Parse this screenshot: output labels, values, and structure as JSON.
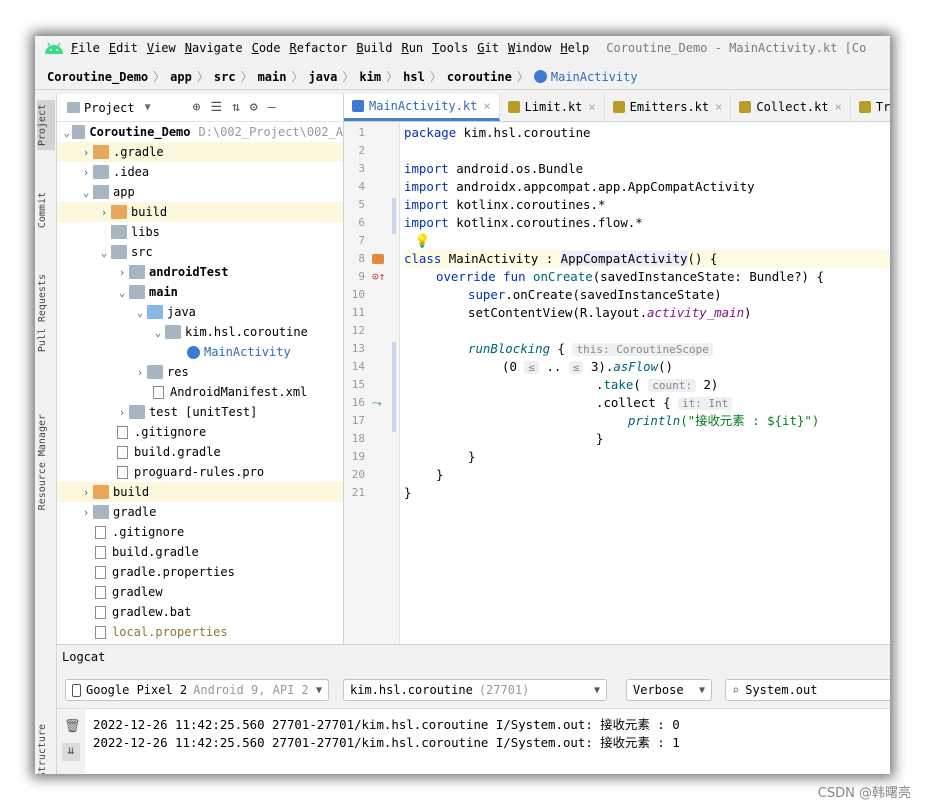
{
  "menu": {
    "items": [
      "File",
      "Edit",
      "View",
      "Navigate",
      "Code",
      "Refactor",
      "Build",
      "Run",
      "Tools",
      "Git",
      "Window",
      "Help"
    ],
    "title": "Coroutine_Demo - MainActivity.kt [Co"
  },
  "breadcrumb": [
    "Coroutine_Demo",
    "app",
    "src",
    "main",
    "java",
    "kim",
    "hsl",
    "coroutine",
    "MainActivity"
  ],
  "leftstrip": [
    "Project",
    "Commit",
    "Pull Requests",
    "Resource Manager",
    "Structure"
  ],
  "project": {
    "label": "Project",
    "rows": [
      {
        "name": "Coroutine_Demo",
        "extra": "D:\\002_Project\\002_A"
      },
      {
        "name": ".gradle"
      },
      {
        "name": ".idea"
      },
      {
        "name": "app"
      },
      {
        "name": "build"
      },
      {
        "name": "libs"
      },
      {
        "name": "src"
      },
      {
        "name": "androidTest"
      },
      {
        "name": "main"
      },
      {
        "name": "java"
      },
      {
        "name": "kim.hsl.coroutine"
      },
      {
        "name": "MainActivity"
      },
      {
        "name": "res"
      },
      {
        "name": "AndroidManifest.xml"
      },
      {
        "name": "test [unitTest]"
      },
      {
        "name": ".gitignore"
      },
      {
        "name": "build.gradle"
      },
      {
        "name": "proguard-rules.pro"
      },
      {
        "name": "build"
      },
      {
        "name": "gradle"
      },
      {
        "name": ".gitignore"
      },
      {
        "name": "build.gradle"
      },
      {
        "name": "gradle.properties"
      },
      {
        "name": "gradlew"
      },
      {
        "name": "gradlew.bat"
      },
      {
        "name": "local.properties"
      }
    ]
  },
  "tabs": [
    "MainActivity.kt",
    "Limit.kt",
    "Emitters.kt",
    "Collect.kt",
    "Tr"
  ],
  "editor": {
    "line_numbers": [
      "1",
      "2",
      "3",
      "4",
      "5",
      "6",
      "7",
      "8",
      "9",
      "10",
      "11",
      "12",
      "13",
      "14",
      "15",
      "16",
      "17",
      "18",
      "19",
      "20",
      "21"
    ],
    "t": {
      "package": "package",
      "pkg": " kim.hsl.coroutine",
      "import": "import",
      "i1": " android.os.Bundle",
      "i2": " androidx.appcompat.app.AppCompatActivity",
      "i3": " kotlinx.coroutines.*",
      "i4": " kotlinx.coroutines.flow.*",
      "class": "class",
      "cname": " MainActivity : ",
      "super": "AppCompatActivity",
      "cend": "() {",
      "override": "override",
      "fun": " fun ",
      "onCreate": "onCreate",
      "ocargs": "(savedInstanceState: Bundle?) {",
      "superkw": "super",
      "sc": ".onCreate(savedInstanceState)",
      "scv": "setContentView(R.layout.",
      "am": "activity_main",
      "scvend": ")",
      "runBlocking": "runBlocking",
      "rbend": " { ",
      "hint_this": "this: CoroutineScope",
      "range_a": "(0 ",
      "le1": "≤",
      "dots": " .. ",
      "le2": "≤",
      "range_b": " 3).",
      "asFlow": "asFlow",
      "paren": "()",
      "take_dot": ".",
      "take": "take",
      "take_open": "( ",
      "hint_count": "count:",
      "take_val": " 2)",
      "collect": ".collect { ",
      "hint_it": "it: Int",
      "println": "println",
      "pstr": "(\"接收元素 : ${it}\")",
      "brace": "}",
      "brace2": "}",
      "brace3": "}",
      "brace4": "}"
    }
  },
  "logcat": {
    "title": "Logcat",
    "device": "Google Pixel 2",
    "device_sub": "Android 9, API 2",
    "process": "kim.hsl.coroutine",
    "process_pid": "(27701)",
    "level": "Verbose",
    "search": "System.out",
    "lines": [
      "2022-12-26 11:42:25.560 27701-27701/kim.hsl.coroutine I/System.out: 接收元素 : 0",
      "2022-12-26 11:42:25.560 27701-27701/kim.hsl.coroutine I/System.out: 接收元素 : 1"
    ]
  },
  "watermark": "CSDN @韩曙亮",
  "colors": {
    "accent": "#4083c9",
    "keyword": "#0033b3",
    "highlight": "#fbf8de"
  }
}
